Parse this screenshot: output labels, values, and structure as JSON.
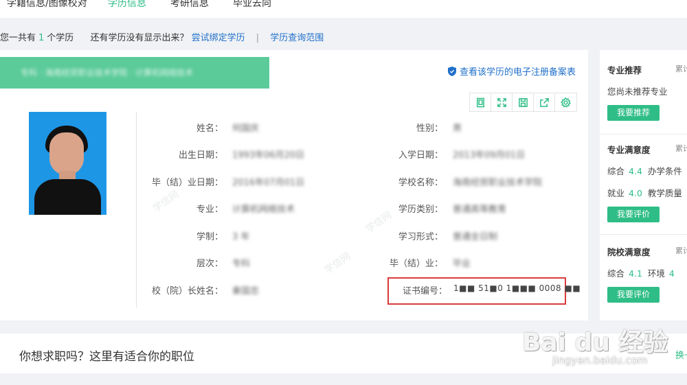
{
  "nav": {
    "tabs": [
      {
        "label": "学籍信息/图像校对",
        "active": false
      },
      {
        "label": "学历信息",
        "active": true
      },
      {
        "label": "考研信息",
        "active": false
      },
      {
        "label": "毕业去向",
        "active": false
      }
    ]
  },
  "summary": {
    "prefix": "您一共有",
    "count": "1",
    "suffix": "个学历",
    "question": "还有学历没有显示出来？",
    "bind_link": "尝试绑定学历",
    "separator": "|",
    "range_link": "学历查询范围"
  },
  "record": {
    "banner_text": "专科 · 海南经贸职业技术学院 · 计算机网络技术",
    "registration_link": "查看该学历的电子注册备案表",
    "fields_left": [
      {
        "label": "姓名：",
        "value": "何国庆"
      },
      {
        "label": "出生日期：",
        "value": "1993年06月20日"
      },
      {
        "label": "毕（结）业日期：",
        "value": "2016年07月01日"
      },
      {
        "label": "专业：",
        "value": "计算机网络技术"
      },
      {
        "label": "学制：",
        "value": "3 年"
      },
      {
        "label": "层次：",
        "value": "专科"
      },
      {
        "label": "校（院）长姓名：",
        "value": "秦国忠"
      }
    ],
    "fields_right": [
      {
        "label": "性别：",
        "value": "男"
      },
      {
        "label": "入学日期：",
        "value": "2013年09月01日"
      },
      {
        "label": "学校名称：",
        "value": "海南经贸职业技术学院"
      },
      {
        "label": "学历类别：",
        "value": "普通高等教育"
      },
      {
        "label": "学习形式：",
        "value": "普通全日制"
      },
      {
        "label": "毕（结）业：",
        "value": "毕业"
      }
    ],
    "certificate": {
      "label": "证书编号：",
      "value": "1■■ 51■0 1■■■ 0008 ■■"
    },
    "watermark_text": "学信网"
  },
  "toolbar": {
    "icons": [
      "document-icon",
      "fullscreen-icon",
      "save-icon",
      "share-icon",
      "settings-icon"
    ]
  },
  "sidebar": {
    "major_recommend": {
      "title": "专业推荐",
      "accum": "累计",
      "text": "您尚未推荐专业",
      "button": "我要推荐"
    },
    "major_satisfaction": {
      "title": "专业满意度",
      "accum": "累计",
      "rows": [
        {
          "label": "综合",
          "score": "4.4",
          "label2": "办学条件"
        },
        {
          "label": "就业",
          "score": "4.0",
          "label2": "教学质量"
        }
      ],
      "button": "我要评价"
    },
    "school_satisfaction": {
      "title": "院校满意度",
      "accum": "累计",
      "rows": [
        {
          "label": "综合",
          "score": "4.1",
          "label2": "环境",
          "score2": "4"
        }
      ],
      "button": "我要评价"
    }
  },
  "jobs": {
    "title": "你想求职吗？这里有适合你的职位",
    "swap": "换一"
  },
  "overlay": {
    "logo": "Bai du 经验",
    "sub": "jingyan.baidu.com"
  },
  "colors": {
    "accent": "#2ebd86",
    "link": "#1f6fc9",
    "highlight": "#d93a3a"
  }
}
